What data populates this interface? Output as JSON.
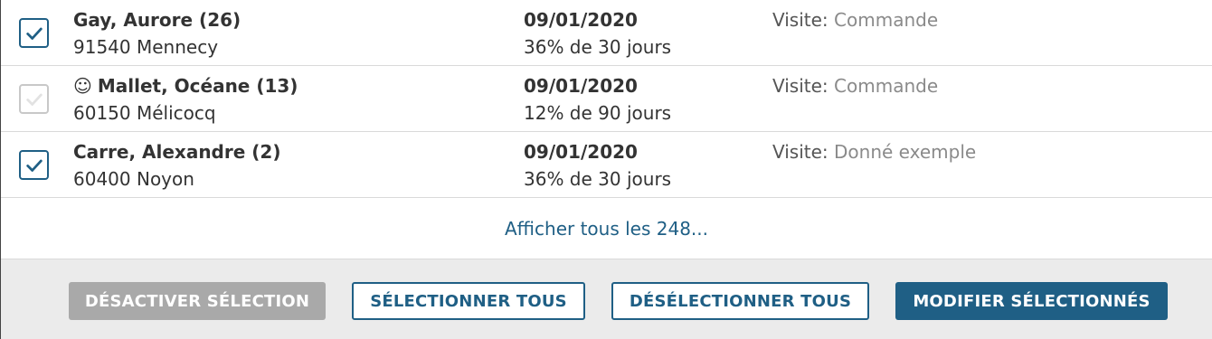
{
  "accent_color": "#1f5f85",
  "rows": [
    {
      "checked": true,
      "disabled": false,
      "icon": "",
      "name": "Gay, Aurore (26)",
      "city": "91540 Mennecy",
      "date": "09/01/2020",
      "terms": "36% de 30 jours",
      "visit_label": "Visite:",
      "visit_value": "Commande"
    },
    {
      "checked": true,
      "disabled": true,
      "icon": "☺",
      "name": "Mallet, Océane (13)",
      "city": "60150 Mélicocq",
      "date": "09/01/2020",
      "terms": "12% de 90 jours",
      "visit_label": "Visite:",
      "visit_value": "Commande"
    },
    {
      "checked": true,
      "disabled": false,
      "icon": "",
      "name": "Carre, Alexandre (2)",
      "city": "60400 Noyon",
      "date": "09/01/2020",
      "terms": "36% de 30 jours",
      "visit_label": "Visite:",
      "visit_value": "Donné exemple"
    }
  ],
  "show_all": "Afficher tous les 248...",
  "buttons": {
    "disable_selection": "DÉSACTIVER SÉLECTION",
    "select_all": "SÉLECTIONNER TOUS",
    "deselect_all": "DÉSÉLECTIONNER TOUS",
    "edit_selected": "MODIFIER SÉLECTIONNÉS"
  }
}
